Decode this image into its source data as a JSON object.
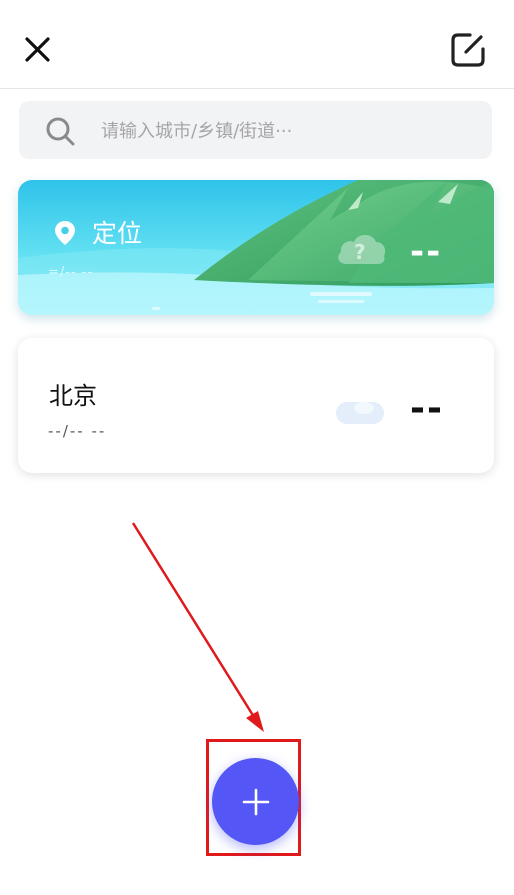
{
  "header": {
    "close_icon": "close-icon",
    "edit_icon": "edit-icon"
  },
  "search": {
    "placeholder": "请输入城市/乡镇/街道···",
    "icon": "search-icon"
  },
  "location_card": {
    "title": "定位",
    "date": "=/--  --",
    "temperature": "--",
    "pin_icon": "location-pin-icon",
    "weather_icon": "cloud-question-icon"
  },
  "cities": [
    {
      "name": "北京",
      "date": "--/--  --",
      "temperature": "--",
      "weather_icon": "cloud-icon"
    }
  ],
  "fab": {
    "icon": "plus-icon"
  },
  "annotation": {
    "color": "#e0191b"
  },
  "colors": {
    "accent": "#5457f6",
    "card_sky": "#4fd8ee",
    "mountain": "#3fa86a"
  }
}
